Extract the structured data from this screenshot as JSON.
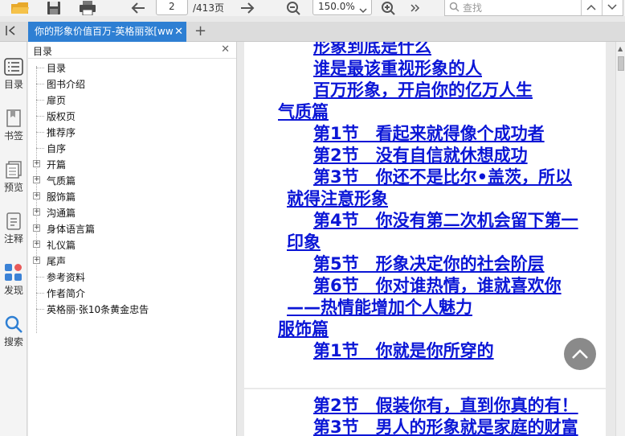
{
  "toolbar": {
    "page_current": "2",
    "page_total": "/413页",
    "zoom": "150.0%",
    "search_placeholder": "查找"
  },
  "tab": {
    "title": "你的形象价值百万-英格丽张[ww"
  },
  "rail": [
    {
      "label": "目录"
    },
    {
      "label": "书签"
    },
    {
      "label": "预览"
    },
    {
      "label": "注释"
    },
    {
      "label": "发现"
    },
    {
      "label": "搜索"
    }
  ],
  "toc": {
    "title": "目录",
    "items": [
      {
        "label": "目录",
        "expandable": false
      },
      {
        "label": "图书介绍",
        "expandable": false
      },
      {
        "label": "扉页",
        "expandable": false
      },
      {
        "label": "版权页",
        "expandable": false
      },
      {
        "label": "推荐序",
        "expandable": false
      },
      {
        "label": "自序",
        "expandable": false
      },
      {
        "label": "开篇",
        "expandable": true
      },
      {
        "label": "气质篇",
        "expandable": true
      },
      {
        "label": "服饰篇",
        "expandable": true
      },
      {
        "label": "沟通篇",
        "expandable": true
      },
      {
        "label": "身体语言篇",
        "expandable": true
      },
      {
        "label": "礼仪篇",
        "expandable": true
      },
      {
        "label": "尾声",
        "expandable": true
      },
      {
        "label": "参考资料",
        "expandable": false
      },
      {
        "label": "作者简介",
        "expandable": false
      },
      {
        "label": "英格丽·张10条黄金忠告",
        "expandable": false
      }
    ]
  },
  "document": {
    "page1_lines": [
      {
        "text": "形象到底是什么",
        "indent": 2
      },
      {
        "text": "谁是最该重视形象的人",
        "indent": 2
      },
      {
        "text": "百万形象，开启你的亿万人生",
        "indent": 2
      },
      {
        "text": "气质篇",
        "indent": 0
      },
      {
        "text": "第1节　看起来就得像个成功者",
        "indent": 2
      },
      {
        "text": "第2节　没有自信就休想成功",
        "indent": 2
      },
      {
        "text": "第3节　你还不是比尔•盖茨，所以",
        "indent": 2
      },
      {
        "text": "就得注意形象",
        "indent": 1
      },
      {
        "text": "第4节　你没有第二次机会留下第一",
        "indent": 2
      },
      {
        "text": "印象",
        "indent": 1
      },
      {
        "text": "第5节　形象决定你的社会阶层",
        "indent": 2
      },
      {
        "text": "第6节　你对谁热情，谁就喜欢你",
        "indent": 2
      },
      {
        "text": "——热情能增加个人魅力",
        "indent": 1
      },
      {
        "text": "服饰篇",
        "indent": 0
      },
      {
        "text": "第1节　你就是你所穿的",
        "indent": 2
      }
    ],
    "page2_lines": [
      {
        "text": "第2节　假装你有，直到你真的有！",
        "indent": 2
      },
      {
        "text": "第3节　男人的形象就是家庭的财富",
        "indent": 2
      }
    ]
  },
  "colors": {
    "tab_active": "#2e7fd3",
    "link": "#0b16d6"
  }
}
